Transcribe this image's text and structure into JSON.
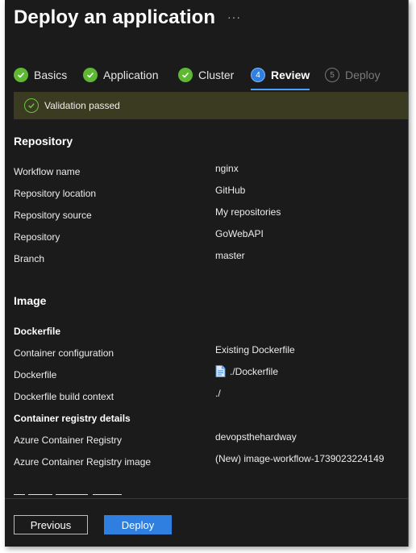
{
  "header": {
    "title": "Deploy an application",
    "more": "···"
  },
  "steps": [
    {
      "label": "Basics",
      "state": "done"
    },
    {
      "label": "Application",
      "state": "done"
    },
    {
      "label": "Cluster",
      "state": "done"
    },
    {
      "label": "Review",
      "state": "active",
      "number": "4"
    },
    {
      "label": "Deploy",
      "state": "disabled",
      "number": "5"
    }
  ],
  "banner": {
    "text": "Validation passed"
  },
  "repository": {
    "heading": "Repository",
    "rows": [
      {
        "label": "Workflow name",
        "value": "nginx"
      },
      {
        "label": "Repository location",
        "value": "GitHub"
      },
      {
        "label": "Repository source",
        "value": "My repositories"
      },
      {
        "label": "Repository",
        "value": "GoWebAPI"
      },
      {
        "label": "Branch",
        "value": "master"
      }
    ]
  },
  "image": {
    "heading": "Image",
    "dockerfile_heading": "Dockerfile",
    "dockerfile_rows": [
      {
        "label": "Container configuration",
        "value": "Existing Dockerfile"
      },
      {
        "label": "Dockerfile",
        "value": "./Dockerfile"
      },
      {
        "label": "Dockerfile build context",
        "value": "./"
      }
    ],
    "registry_heading": "Container registry details",
    "registry_rows": [
      {
        "label": "Azure Container Registry",
        "value": "devopsthehardway"
      },
      {
        "label": "Azure Container Registry image",
        "value": "(New) image-workflow-1739023224149"
      }
    ]
  },
  "footer": {
    "previous_label": "Previous",
    "deploy_label": "Deploy"
  },
  "colors": {
    "accent": "#2f7fe0",
    "success": "#5fb832",
    "banner_bg": "#3b3b21",
    "background": "#1b1b1b"
  },
  "icons": {
    "done": "checkmark-circle-icon",
    "file": "file-icon",
    "more": "more-icon"
  }
}
